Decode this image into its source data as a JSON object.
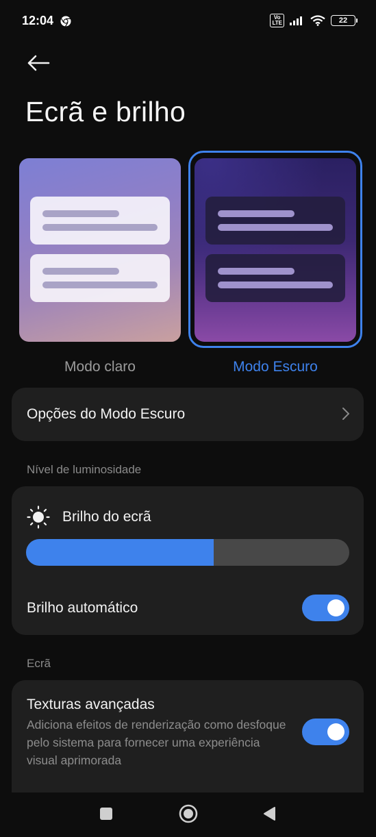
{
  "status_bar": {
    "time": "12:04",
    "volte_line1": "Vo",
    "volte_line2": "LTE",
    "battery": "22"
  },
  "header": {
    "title": "Ecrã e brilho"
  },
  "modes": {
    "light_label": "Modo claro",
    "dark_label": "Modo Escuro",
    "selected": "Modo Escuro"
  },
  "dark_options": {
    "label": "Opções do Modo Escuro"
  },
  "brightness_section": {
    "title": "Nível de luminosidade",
    "brightness_label": "Brilho do ecrã",
    "brightness_level_percent": 58,
    "auto_label": "Brilho automático",
    "auto_enabled": true
  },
  "screen_section": {
    "title": "Ecrã",
    "textures_title": "Texturas avançadas",
    "textures_desc": "Adiciona efeitos de renderização como desfoque pelo sistema para fornecer uma experiência visual aprimorada",
    "textures_enabled": true
  },
  "colors": {
    "accent": "#3e82ec",
    "background": "#0d0d0d",
    "card": "#1f1f1f"
  },
  "icons": {
    "chrome": "chrome-icon",
    "back": "back-arrow-icon",
    "chevron": "chevron-right-icon",
    "sun": "sun-icon",
    "nav_recents": "square-icon",
    "nav_home": "circle-icon",
    "nav_back": "triangle-back-icon"
  }
}
